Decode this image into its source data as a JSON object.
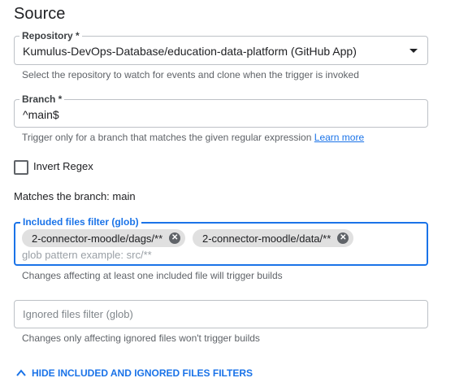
{
  "section_title": "Source",
  "repository": {
    "label": "Repository *",
    "value": "Kumulus-DevOps-Database/education-data-platform (GitHub App)",
    "hint": "Select the repository to watch for events and clone when the trigger is invoked"
  },
  "branch": {
    "label": "Branch *",
    "value": "^main$",
    "hint": "Trigger only for a branch that matches the given regular expression",
    "hint_link": "Learn more"
  },
  "invert_regex": {
    "label": "Invert Regex",
    "checked": false
  },
  "matches_text": "Matches the branch: main",
  "included_filter": {
    "label": "Included files filter (glob)",
    "chips": [
      "2-connector-moodle/dags/**",
      "2-connector-moodle/data/**"
    ],
    "placeholder": "glob pattern example: src/**",
    "hint": "Changes affecting at least one included file will trigger builds"
  },
  "ignored_filter": {
    "placeholder": "Ignored files filter (glob)",
    "hint": "Changes only affecting ignored files won't trigger builds"
  },
  "toggle_label": "HIDE INCLUDED AND IGNORED FILES FILTERS",
  "colors": {
    "accent": "#1a73e8",
    "border": "#bdc1c6",
    "chip": "#e0e0e0"
  }
}
